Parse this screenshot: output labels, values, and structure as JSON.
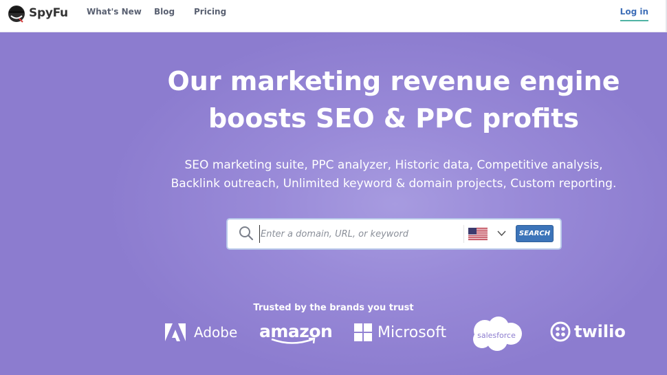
{
  "header": {
    "logo_text": "SpyFu",
    "nav": [
      {
        "label": "What's New"
      },
      {
        "label": "Blog"
      },
      {
        "label": "Pricing"
      }
    ],
    "login_label": "Log in"
  },
  "hero": {
    "headline_line1": "Our marketing revenue engine",
    "headline_line2": "boosts SEO & PPC profits",
    "subline_line1": "SEO marketing suite, PPC analyzer, Historic data, Competitive analysis,",
    "subline_line2": "Backlink outreach, Unlimited keyword & domain projects, Custom reporting."
  },
  "search": {
    "placeholder": "Enter a domain, URL, or keyword",
    "value": "",
    "country_icon": "us-flag-icon",
    "button_label": "SEARCH"
  },
  "trusted": {
    "label": "Trusted by the brands you trust",
    "brands": [
      {
        "name": "Adobe",
        "icon": "adobe-logo-icon"
      },
      {
        "name": "amazon",
        "icon": "amazon-smile-icon"
      },
      {
        "name": "Microsoft",
        "icon": "microsoft-logo-icon"
      },
      {
        "name": "salesforce",
        "icon": "salesforce-cloud-icon"
      },
      {
        "name": "twilio",
        "icon": "twilio-logo-icon"
      }
    ]
  },
  "colors": {
    "hero_bg": "#8c7ccf",
    "search_button": "#3c74b9",
    "login_underline": "#4fb3a4",
    "login_text": "#3f6fb8"
  }
}
